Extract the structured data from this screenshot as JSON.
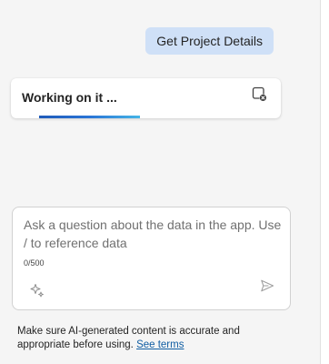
{
  "chat": {
    "user_message": "Get Project Details",
    "working_label": "Working on it ...",
    "progress": 0.35
  },
  "input": {
    "placeholder": "Ask a question about the data in the app. Use / to reference data",
    "value": "",
    "char_count": "0/500"
  },
  "disclaimer": {
    "text": "Make sure AI-generated content is accurate and appropriate before using.",
    "link_label": "See terms"
  },
  "icons": {
    "cancel": "stop-response-icon",
    "sparkle": "sparkle-icon",
    "send": "send-icon"
  },
  "colors": {
    "user_bubble": "#cfe0f7",
    "progress_start": "#1f5bb9",
    "progress_end": "#45b5e6",
    "link": "#115ea3"
  }
}
